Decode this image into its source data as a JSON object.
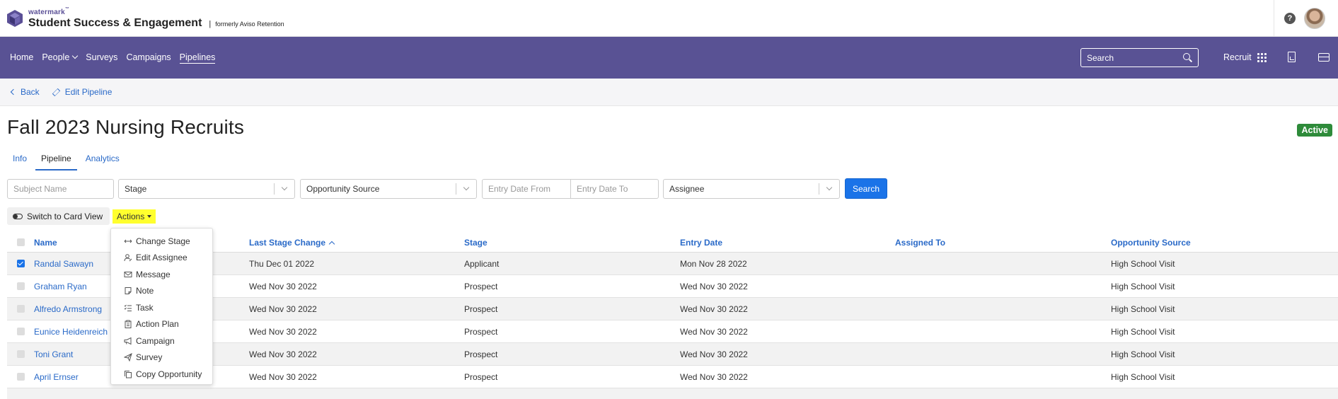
{
  "brand": {
    "watermark": "watermark",
    "tm": "™",
    "product": "Student Success & Engagement",
    "separator": "|",
    "formerly": "formerly Aviso Retention"
  },
  "header": {
    "help": "?"
  },
  "nav": {
    "items": [
      "Home",
      "People",
      "Surveys",
      "Campaigns",
      "Pipelines"
    ],
    "active": "Pipelines",
    "search_placeholder": "Search",
    "recruit_label": "Recruit"
  },
  "subnav": {
    "back": "Back",
    "edit": "Edit Pipeline"
  },
  "page": {
    "title": "Fall 2023 Nursing Recruits",
    "status": "Active",
    "status_color": "#2e8b3a",
    "tabs": [
      "Info",
      "Pipeline",
      "Analytics"
    ],
    "active_tab": "Pipeline"
  },
  "filters": {
    "subject_name_placeholder": "Subject Name",
    "stage": "Stage",
    "opportunity_source": "Opportunity Source",
    "entry_date_from": "Entry Date From",
    "entry_date_to": "Entry Date To",
    "assignee": "Assignee",
    "search_button": "Search"
  },
  "toolbar": {
    "switch_view": "Switch to Card View",
    "actions": "Actions"
  },
  "actions_menu": [
    {
      "label": "Change Stage",
      "icon": "arrows-horizontal-icon"
    },
    {
      "label": "Edit Assignee",
      "icon": "user-edit-icon"
    },
    {
      "label": "Message",
      "icon": "envelope-icon"
    },
    {
      "label": "Note",
      "icon": "note-icon"
    },
    {
      "label": "Task",
      "icon": "checklist-icon"
    },
    {
      "label": "Action Plan",
      "icon": "clipboard-icon"
    },
    {
      "label": "Campaign",
      "icon": "megaphone-icon"
    },
    {
      "label": "Survey",
      "icon": "paper-plane-icon"
    },
    {
      "label": "Copy Opportunity",
      "icon": "copy-icon"
    }
  ],
  "table": {
    "headers": {
      "name": "Name",
      "last_stage_change": "Last Stage Change",
      "stage": "Stage",
      "entry_date": "Entry Date",
      "assigned_to": "Assigned To",
      "opportunity_source": "Opportunity Source"
    },
    "rows": [
      {
        "checked": true,
        "name": "Randal Sawayn",
        "last": "Thu Dec 01 2022",
        "stage": "Applicant",
        "entry": "Mon Nov 28 2022",
        "assigned": "",
        "source": "High School Visit"
      },
      {
        "checked": false,
        "name": "Graham Ryan",
        "last": "Wed Nov 30 2022",
        "stage": "Prospect",
        "entry": "Wed Nov 30 2022",
        "assigned": "",
        "source": "High School Visit"
      },
      {
        "checked": false,
        "name": "Alfredo Armstrong",
        "last": "Wed Nov 30 2022",
        "stage": "Prospect",
        "entry": "Wed Nov 30 2022",
        "assigned": "",
        "source": "High School Visit"
      },
      {
        "checked": false,
        "name": "Eunice Heidenreich",
        "last": "Wed Nov 30 2022",
        "stage": "Prospect",
        "entry": "Wed Nov 30 2022",
        "assigned": "",
        "source": "High School Visit"
      },
      {
        "checked": false,
        "name": "Toni Grant",
        "last": "Wed Nov 30 2022",
        "stage": "Prospect",
        "entry": "Wed Nov 30 2022",
        "assigned": "",
        "source": "High School Visit"
      },
      {
        "checked": false,
        "name": "April Ernser",
        "last": "Wed Nov 30 2022",
        "stage": "Prospect",
        "entry": "Wed Nov 30 2022",
        "assigned": "",
        "source": "High School Visit"
      }
    ]
  },
  "colors": {
    "nav_bg": "#595294",
    "link": "#2a6ac8",
    "primary": "#1a73e8",
    "highlight": "#ffff2e"
  }
}
